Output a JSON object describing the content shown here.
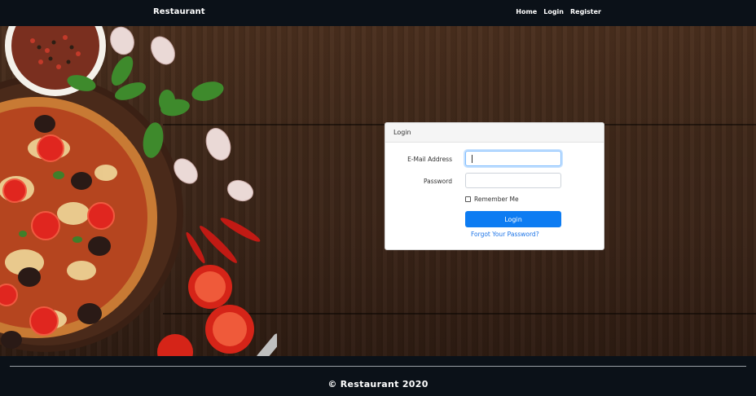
{
  "navbar": {
    "brand": "Restaurant",
    "links": [
      "Home",
      "Login",
      "Register"
    ]
  },
  "login_card": {
    "header": "Login",
    "email_label": "E-Mail Address",
    "email_value": "",
    "password_label": "Password",
    "password_value": "",
    "remember_label": "Remember Me",
    "remember_checked": false,
    "submit_label": "Login",
    "forgot_label": "Forgot Your Password?"
  },
  "footer": {
    "text": "© Restaurant 2020"
  },
  "colors": {
    "nav_bg": "#0b1118",
    "primary": "#0d7cf2",
    "link": "#1a73e8",
    "wood": "#3f281a"
  },
  "icons": {
    "hero": "pizza-on-wood-background"
  }
}
